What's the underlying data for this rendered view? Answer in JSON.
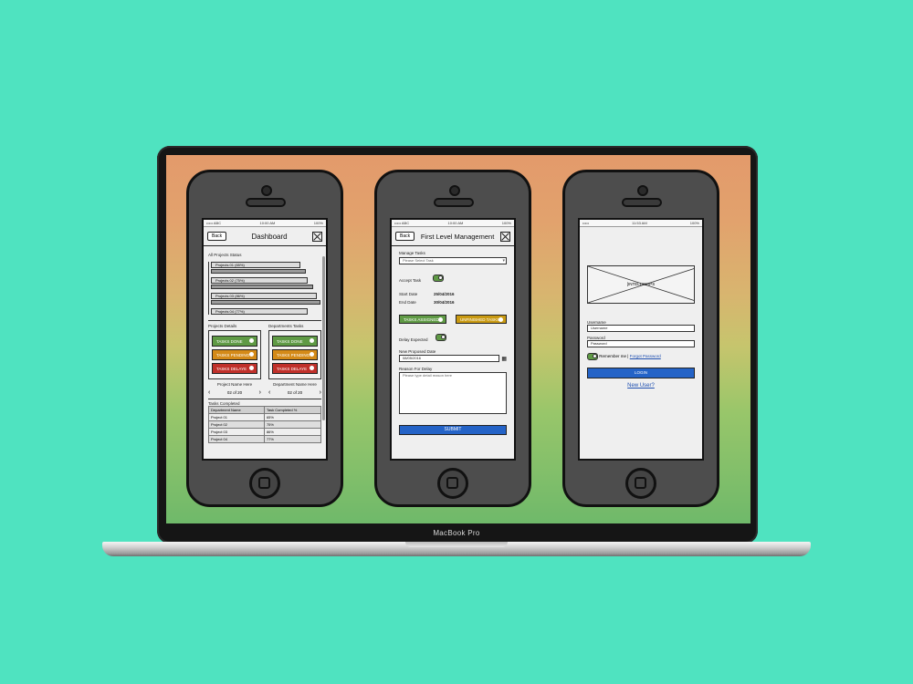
{
  "laptop": {
    "label": "MacBook Pro"
  },
  "dashboard": {
    "status_left": "••••• ABC",
    "status_time": "10:00 AM",
    "status_right": "100%",
    "back_label": "Back",
    "title": "Dashboard",
    "all_projects_label": "All Projects Status",
    "project_bars": [
      "Projects 01 (65%)",
      "Projects 02 (75%)",
      "Projects 03 (86%)",
      "Projects 04 (77%)"
    ],
    "project_bar_values": [
      0.65,
      0.75,
      0.86,
      0.77
    ],
    "projects_details_label": "Projects Details",
    "departments_tasks_label": "Departments Tasks",
    "tasks_done": "TASKS DONE",
    "tasks_pending": "TASKS PENDING",
    "tasks_delayed": "TASKS DELAYE",
    "project_name": "Project Name Here",
    "department_name": "Department Name Here",
    "pager_left": "02 of 20",
    "pager_right": "02 of 20",
    "tasks_completed_label": "Tasks Completed",
    "table_headers": [
      "Department Name",
      "Task Completed %"
    ],
    "table_rows": [
      [
        "Project 01",
        "65%"
      ],
      [
        "Project 02",
        "75%"
      ],
      [
        "Project 03",
        "86%"
      ],
      [
        "Project 04",
        "77%"
      ]
    ]
  },
  "management": {
    "status_left": "••••• ABC",
    "status_time": "10:00 AM",
    "status_right": "100%",
    "back_label": "Back",
    "title": "First Level Management",
    "manage_tasks_label": "Manage Tasks",
    "select_placeholder": "Please Select Task",
    "accept_task_label": "Accept Task",
    "start_date_label": "Start Date",
    "start_date_value": "25/04/2016",
    "end_date_label": "End Date",
    "end_date_value": "30/04/2016",
    "tasks_assigned": "TASKS ASSIGNED",
    "unfinished_tasks": "UNFINISHED TASKS",
    "delay_expected_label": "Delay Expected",
    "new_proposed_date_label": "New Proposed Date",
    "new_proposed_date_value": "08/05/2016",
    "reason_label": "Reason For Delay",
    "reason_placeholder": "Please type detail reason here",
    "submit_label": "SUBMIT"
  },
  "login": {
    "status_left": "•••••",
    "status_time": "11:53 AM",
    "status_right": "100%",
    "image_label": "[INTELLIMAPS",
    "username_label": "Username",
    "username_value": "Username",
    "password_label": "Password",
    "password_value": "Password",
    "remember_label": "Remember me",
    "separator": "|",
    "forgot_label": "Forgot Password",
    "login_label": "LOGIN",
    "new_user_label": "New User?"
  }
}
